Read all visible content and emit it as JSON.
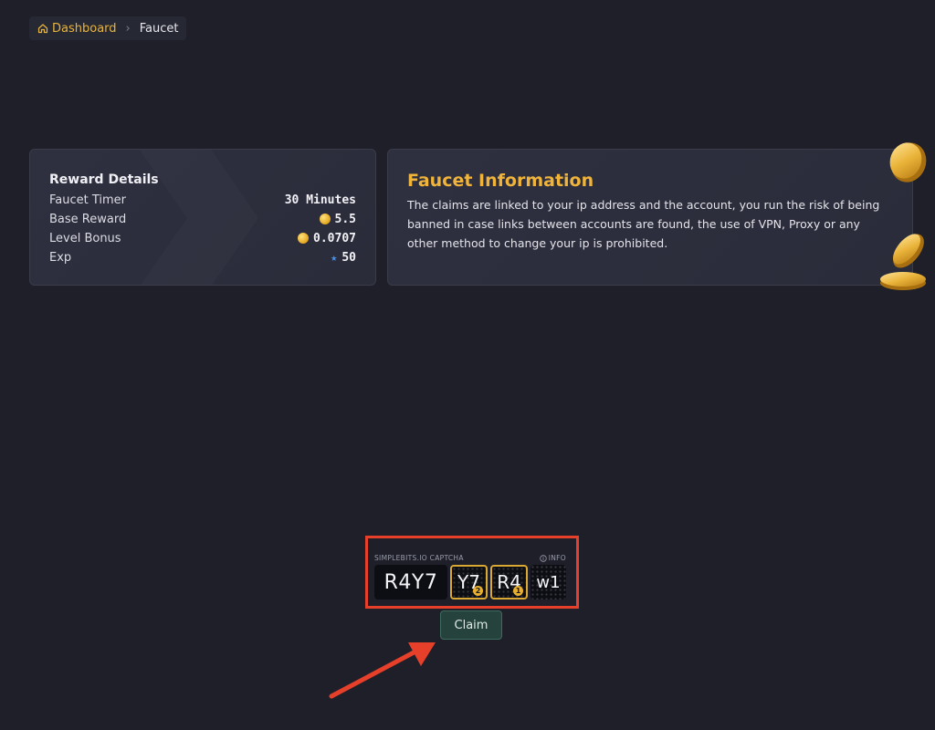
{
  "breadcrumb": {
    "home_label": "Dashboard",
    "separator": "›",
    "current_label": "Faucet"
  },
  "reward": {
    "title": "Reward Details",
    "rows": [
      {
        "label": "Faucet Timer",
        "value": "30 Minutes",
        "icon": "none"
      },
      {
        "label": "Base Reward",
        "value": "5.5",
        "icon": "coin-icon"
      },
      {
        "label": "Level Bonus",
        "value": "0.0707",
        "icon": "coin-icon"
      },
      {
        "label": "Exp",
        "value": "50",
        "icon": "star-icon"
      }
    ]
  },
  "info": {
    "title": "Faucet Information",
    "text": "The claims are linked to your ip address and the account, you run the risk of being banned in case links between accounts are found, the use of VPN, Proxy or any other method to change your ip is prohibited."
  },
  "captcha": {
    "brand": "SIMPLEBITS.IO CAPTCHA",
    "info_label": "INFO",
    "target_code": "R4Y7",
    "tiles": [
      {
        "text": "Y7",
        "selected": true,
        "order": "2"
      },
      {
        "text": "R4",
        "selected": true,
        "order": "1"
      },
      {
        "text": "w1",
        "selected": false,
        "order": ""
      }
    ]
  },
  "claim_label": "Claim",
  "colors": {
    "background": "#1e1f29",
    "accent": "#f0b43a",
    "annotation": "#e6402a",
    "claim_button": "#25433c"
  }
}
